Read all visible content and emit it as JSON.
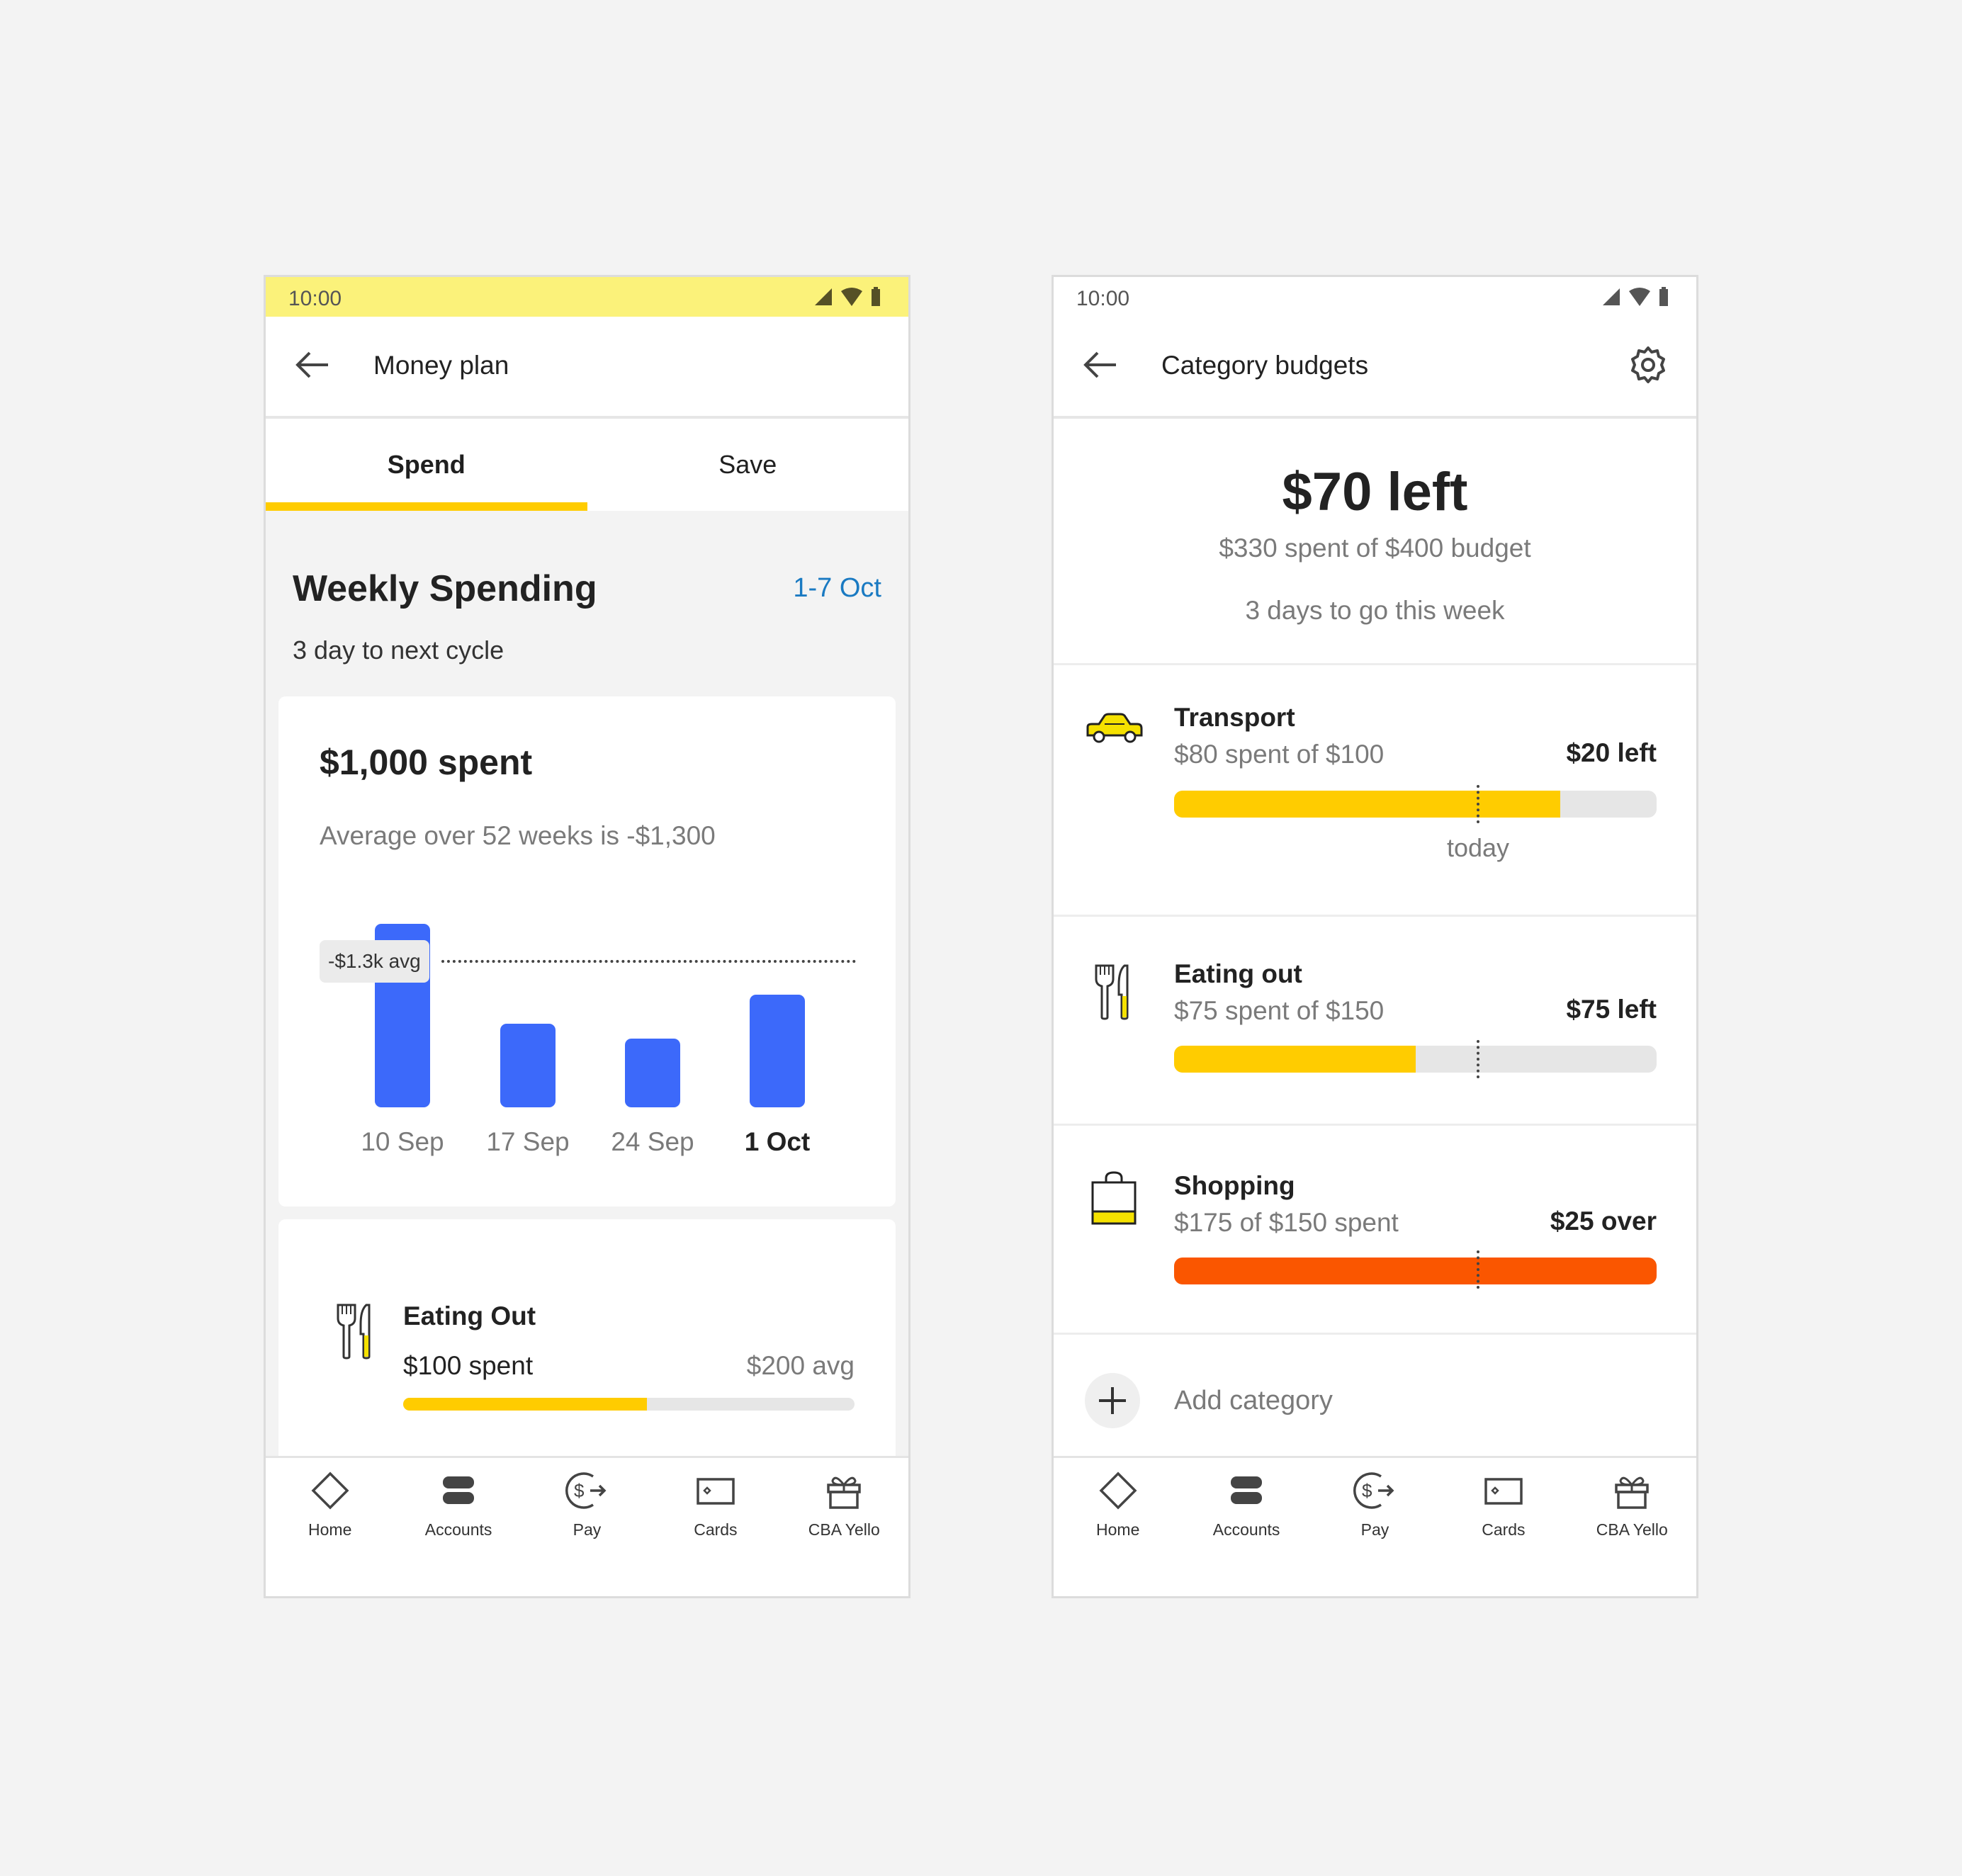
{
  "colors": {
    "accent_yellow": "#ffcc00",
    "status_yellow": "#fbf27a",
    "bar_blue": "#3c69fa",
    "link_blue": "#1a7ac2",
    "over_orange": "#fa5600",
    "track_gray": "#e6e6e6"
  },
  "money_plan": {
    "status_time": "10:00",
    "title": "Money plan",
    "tabs": [
      {
        "label": "Spend",
        "active": true
      },
      {
        "label": "Save",
        "active": false
      }
    ],
    "section_title": "Weekly Spending",
    "date_range": "1-7 Oct",
    "cycle_text": "3 day to next cycle",
    "spent_total": "$1,000 spent",
    "average_text": "Average over 52 weeks is -$1,300",
    "avg_label": "-$1.3k avg",
    "category": {
      "name": "Eating Out",
      "spent": "$100 spent",
      "avg": "$200 avg",
      "progress": 0.54
    }
  },
  "chart_data": {
    "type": "bar",
    "title": "Weekly Spending",
    "categories": [
      "10 Sep",
      "17 Sep",
      "24 Sep",
      "1 Oct"
    ],
    "values": [
      1630,
      740,
      610,
      1000
    ],
    "highlighted_category": "1 Oct",
    "reference_line": {
      "label": "-$1.3k avg",
      "value": 1300,
      "style": "dotted"
    },
    "xlabel": "",
    "ylabel": "",
    "ylim": [
      0,
      1700
    ],
    "grid": false
  },
  "category_budgets": {
    "status_time": "10:00",
    "title": "Category budgets",
    "left_headline": "$70 left",
    "spent_summary": "$330 spent of $400 budget",
    "days_to_go": "3 days to go this week",
    "today_label": "today",
    "today_position": 0.63,
    "categories": [
      {
        "name": "Transport",
        "detail": "$80 spent of $100",
        "status": "$20 left",
        "progress": 0.8,
        "icon": "car-icon",
        "over": false
      },
      {
        "name": "Eating out",
        "detail": "$75 spent of $150",
        "status": "$75 left",
        "progress": 0.5,
        "icon": "cutlery-icon",
        "over": false
      },
      {
        "name": "Shopping",
        "detail": "$175 of $150 spent",
        "status": "$25 over",
        "progress": 1.0,
        "icon": "shopping-bag-icon",
        "over": true
      }
    ],
    "add_category": "Add category"
  },
  "nav": [
    {
      "label": "Home",
      "icon": "home-icon"
    },
    {
      "label": "Accounts",
      "icon": "accounts-icon"
    },
    {
      "label": "Pay",
      "icon": "pay-icon"
    },
    {
      "label": "Cards",
      "icon": "cards-icon"
    },
    {
      "label": "CBA Yello",
      "icon": "gift-icon"
    }
  ]
}
